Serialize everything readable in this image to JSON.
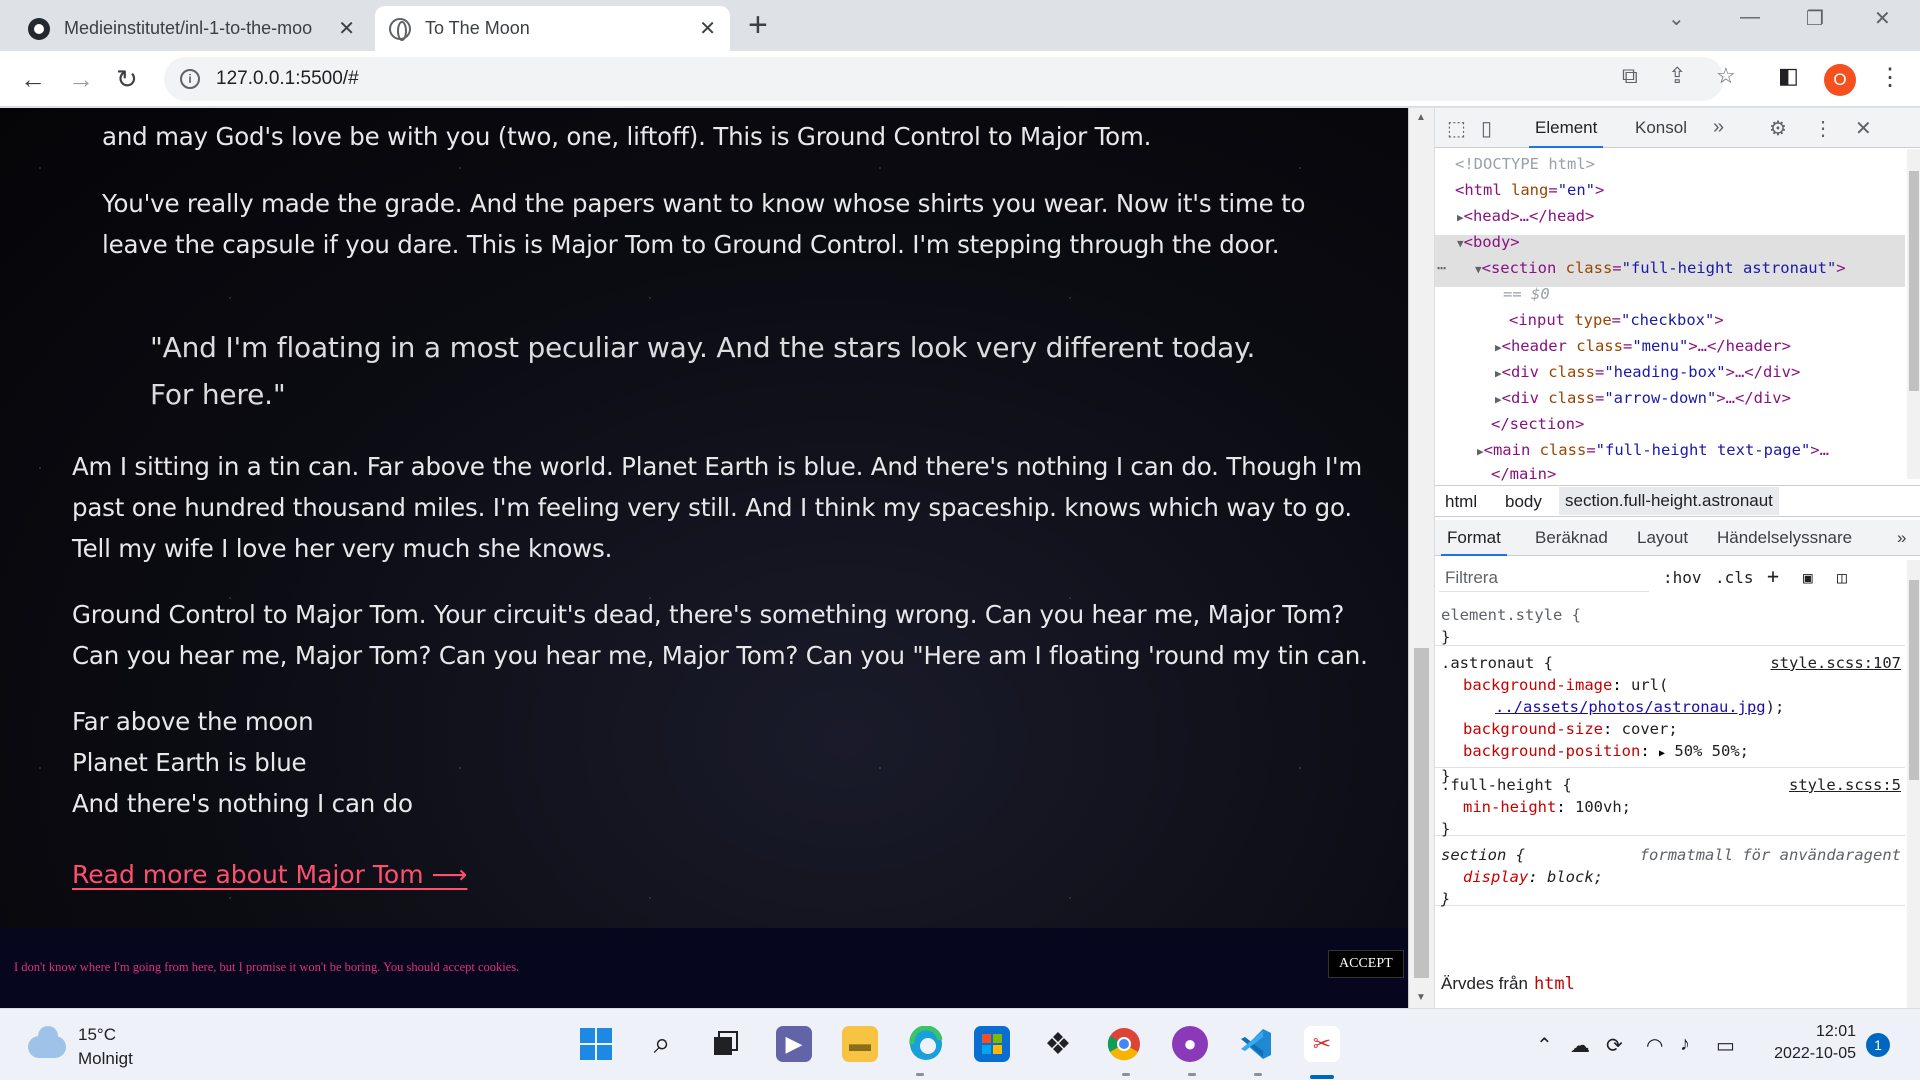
{
  "browser": {
    "tabs": [
      {
        "title": "Medieinstitutet/inl-1-to-the-moo",
        "close": "✕"
      },
      {
        "title": "To The Moon",
        "close": "✕"
      }
    ],
    "new_tab": "+",
    "url": "127.0.0.1:5500/#",
    "profile_initial": "O"
  },
  "page": {
    "para0": "and may God's love be with you (two, one, liftoff). This is Ground Control to Major Tom.",
    "para1_l1": "You've really made the grade. And the papers want to know whose shirts you wear. Now it's time to",
    "para1_l2": "leave the capsule if you dare. This is Major Tom to Ground Control. I'm stepping through the door.",
    "quote_l1": "\"And I'm floating in a most peculiar way. And the stars look very different today.",
    "quote_l2": "For here.\"",
    "para2_l1": "Am I sitting in a tin can. Far above the world. Planet Earth is blue. And there's nothing I can do. Though I'm",
    "para2_l2": "past one hundred thousand miles. I'm feeling very still. And I think my spaceship. knows which way to go.",
    "para2_l3": "Tell my wife I love her very much she knows.",
    "para3_l1": "Ground Control to Major Tom. Your circuit's dead, there's something wrong. Can you hear me, Major Tom?",
    "para3_l2": "Can you hear me, Major Tom? Can you hear me, Major Tom? Can you \"Here am I floating 'round my tin can.",
    "verse": [
      "Far above the moon",
      "Planet Earth is blue",
      "And there's nothing I can do"
    ],
    "read_more": "Read more about Major Tom ⟶",
    "cookie_text": "I don't know where I'm going from here, but I promise it won't be boring. You should accept cookies.",
    "accept": "ACCEPT"
  },
  "devtools": {
    "tabs": [
      "Element",
      "Konsol"
    ],
    "dom": {
      "doctype": "<!DOCTYPE html>",
      "html_open": "<html",
      "html_attr": "lang",
      "html_val": "\"en\"",
      "head": "<head>…</head>",
      "body": "<body>",
      "section_tag": "<section",
      "section_attr": "class",
      "section_val": "\"full-height astronaut\"",
      "eq0": "== $0",
      "input_tag": "<input",
      "input_attr": "type",
      "input_val": "\"checkbox\"",
      "header_tag": "<header",
      "header_attr": "class",
      "header_val": "\"menu\"",
      "header_close": ">…</header>",
      "div1_tag": "<div",
      "div1_attr": "class",
      "div1_val": "\"heading-box\"",
      "div1_close": ">…</div>",
      "div2_tag": "<div",
      "div2_attr": "class",
      "div2_val": "\"arrow-down\"",
      "div2_close": ">…</div>",
      "section_close": "</section>",
      "main_tag": "<main",
      "main_attr": "class",
      "main_val": "\"full-height text-page\"",
      "main_more": ">…",
      "main_close": "</main>"
    },
    "breadcrumbs": [
      "html",
      "body",
      "section.full-height.astronaut"
    ],
    "style_tabs": [
      "Format",
      "Beräknad",
      "Layout",
      "Händelselyssnare"
    ],
    "filter_placeholder": "Filtrera",
    "hov": ":hov",
    "cls": ".cls",
    "rules": {
      "r0_sel": "element.style {",
      "r1_sel": ".astronaut {",
      "r1_src": "style.scss:107",
      "r1_p1": "background-image",
      "r1_v1": "url(",
      "r1_link": "../assets/photos/astronau.jpg",
      "r1_v1b": ");",
      "r1_p2": "background-size",
      "r1_v2": "cover;",
      "r1_p3": "background-position",
      "r1_v3": "50% 50%;",
      "r2_sel": ".full-height {",
      "r2_src": "style.scss:5",
      "r2_p1": "min-height",
      "r2_v1": "100vh;",
      "r3_sel": "section {",
      "r3_src": "formatmall för användaragent",
      "r3_p1": "display",
      "r3_v1": "block;",
      "close": "}"
    },
    "inherited_label": "Ärvdes från",
    "inherited_tag": "html"
  },
  "taskbar": {
    "temp": "15°C",
    "weather": "Molnigt",
    "time": "12:01",
    "date": "2022-10-05",
    "notifications": "1"
  }
}
